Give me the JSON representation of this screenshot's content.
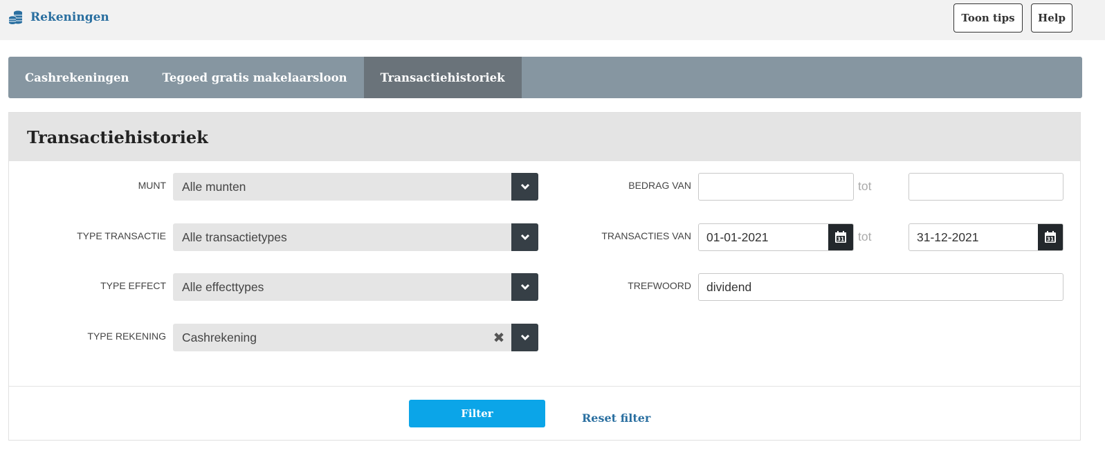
{
  "app": {
    "title": "Rekeningen",
    "icon": "coins-stack-icon"
  },
  "header": {
    "tips_label": "Toon tips",
    "help_label": "Help"
  },
  "tabs": [
    {
      "label": "Cashrekeningen",
      "active": false
    },
    {
      "label": "Tegoed gratis makelaarsloon",
      "active": false
    },
    {
      "label": "Transactiehistoriek",
      "active": true
    }
  ],
  "panel": {
    "title": "Transactiehistoriek",
    "fields": {
      "munt": {
        "label": "MUNT",
        "value": "Alle munten"
      },
      "type_transactie": {
        "label": "TYPE TRANSACTIE",
        "value": "Alle transactietypes"
      },
      "type_effect": {
        "label": "TYPE EFFECT",
        "value": "Alle effecttypes"
      },
      "type_rekening": {
        "label": "TYPE REKENING",
        "value": "Cashrekening",
        "clear_icon": "close-icon"
      },
      "bedrag": {
        "label": "BEDRAG VAN",
        "from": "",
        "separator": "tot",
        "to": ""
      },
      "transacties": {
        "label": "TRANSACTIES VAN",
        "from": "01-01-2021",
        "separator": "tot",
        "to": "31-12-2021",
        "calendar_day": "31"
      },
      "trefwoord": {
        "label": "TREFWOORD",
        "value": "dividend"
      }
    },
    "filter_label": "Filter",
    "reset_label": "Reset filter"
  },
  "colors": {
    "brand": "#2a6fa0",
    "tabbar": "#8696a1",
    "tab_active": "#6a737a",
    "primary_button": "#0ba5e8",
    "select_caret": "#363f46"
  }
}
